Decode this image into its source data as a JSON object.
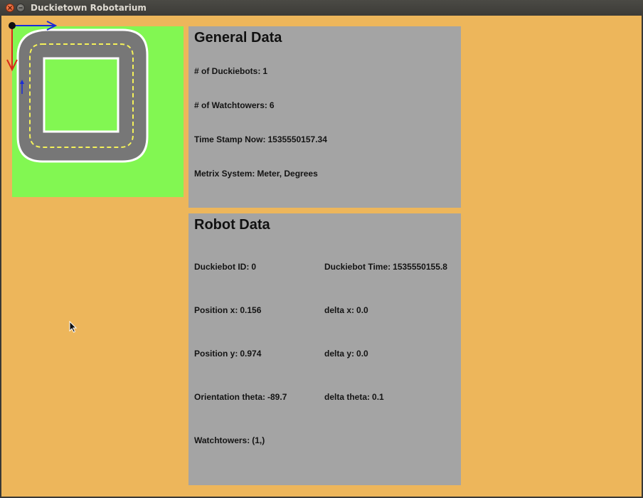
{
  "window": {
    "title": "Duckietown Robotarium"
  },
  "colors": {
    "background": "#edb65b",
    "map_grass": "#82f752",
    "road": "#777777",
    "lane_line": "#f4f15a",
    "panel": "#a4a4a4"
  },
  "map": {
    "icons": [
      "origin-dot-icon",
      "x-axis-arrow-icon",
      "y-axis-arrow-icon",
      "robot-heading-arrow-icon"
    ]
  },
  "general": {
    "title": "General Data",
    "duckiebots_label": "# of Duckiebots:",
    "duckiebots_value": "1",
    "watchtowers_label": "# of Watchtowers:",
    "watchtowers_value": "6",
    "timestamp_label": "Time Stamp Now:",
    "timestamp_value": "1535550157.34",
    "metric_label": "Metrix System:",
    "metric_value": "Meter, Degrees"
  },
  "robot": {
    "title": "Robot Data",
    "id_label": "Duckiebot ID:",
    "id_value": "0",
    "time_label": "Duckiebot Time:",
    "time_value": "1535550155.8",
    "pos_x_label": "Position x:",
    "pos_x_value": "0.156",
    "delta_x_label": "delta x:",
    "delta_x_value": "0.0",
    "pos_y_label": "Position y:",
    "pos_y_value": "0.974",
    "delta_y_label": "delta y:",
    "delta_y_value": "0.0",
    "theta_label": "Orientation theta:",
    "theta_value": "-89.7",
    "delta_theta_label": "delta theta:",
    "delta_theta_value": "0.1",
    "watchtowers_label": "Watchtowers:",
    "watchtowers_value": "(1,)"
  }
}
